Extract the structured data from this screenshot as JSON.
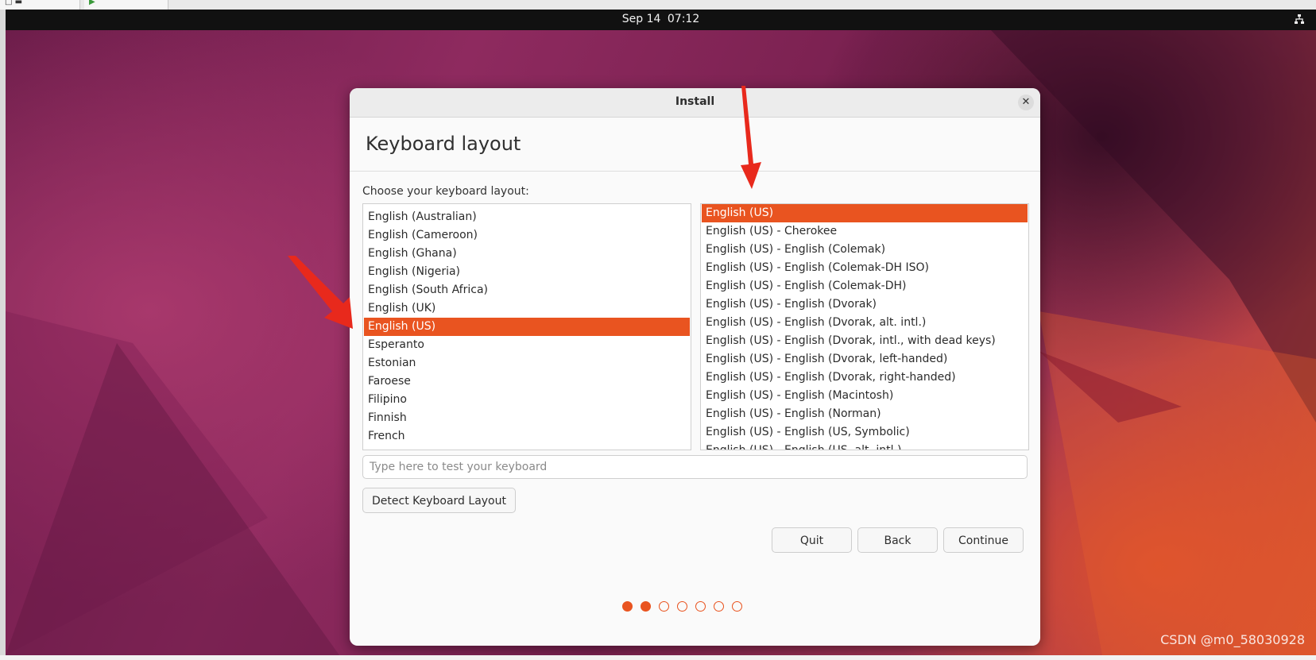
{
  "topbar": {
    "date": "Sep 14",
    "time": "07:12"
  },
  "dialog": {
    "title": "Install",
    "heading": "Keyboard layout",
    "prompt": "Choose your keyboard layout:",
    "layouts": [
      "English (Australian)",
      "English (Cameroon)",
      "English (Ghana)",
      "English (Nigeria)",
      "English (South Africa)",
      "English (UK)",
      "English (US)",
      "Esperanto",
      "Estonian",
      "Faroese",
      "Filipino",
      "Finnish",
      "French"
    ],
    "selected_layout_index": 6,
    "variants": [
      "English (US)",
      "English (US) - Cherokee",
      "English (US) - English (Colemak)",
      "English (US) - English (Colemak-DH ISO)",
      "English (US) - English (Colemak-DH)",
      "English (US) - English (Dvorak)",
      "English (US) - English (Dvorak, alt. intl.)",
      "English (US) - English (Dvorak, intl., with dead keys)",
      "English (US) - English (Dvorak, left-handed)",
      "English (US) - English (Dvorak, right-handed)",
      "English (US) - English (Macintosh)",
      "English (US) - English (Norman)",
      "English (US) - English (US, Symbolic)",
      "English (US) - English (US, alt. intl.)"
    ],
    "selected_variant_index": 0,
    "test_input": {
      "value": "",
      "placeholder": "Type here to test your keyboard"
    },
    "detect_label": "Detect Keyboard Layout",
    "quit_label": "Quit",
    "back_label": "Back",
    "continue_label": "Continue",
    "progress": {
      "total_steps": 7,
      "completed_steps": 2
    }
  },
  "watermark": "CSDN @m0_58030928",
  "colors": {
    "accent": "#e95420",
    "annotation_arrow": "#e8291c"
  },
  "icons": {
    "close": "close-icon",
    "network": "network-icon"
  }
}
